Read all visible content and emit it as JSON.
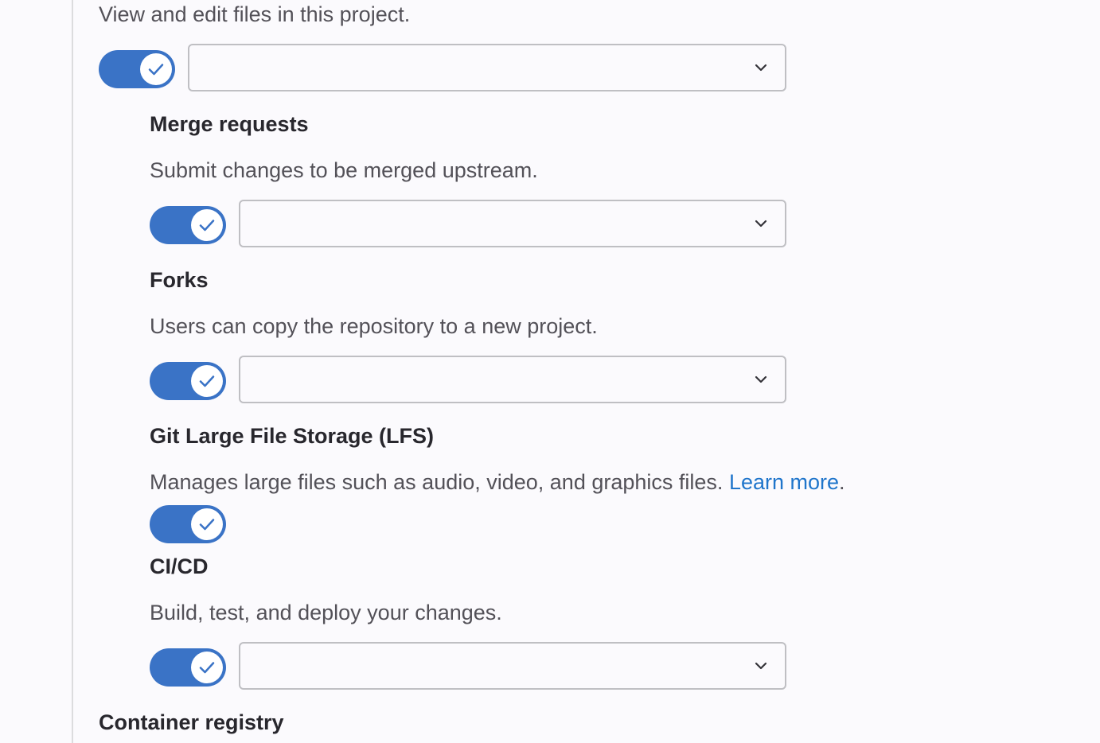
{
  "repository": {
    "description": "View and edit files in this project.",
    "toggle_enabled": true,
    "access_value": ""
  },
  "merge_requests": {
    "title": "Merge requests",
    "description": "Submit changes to be merged upstream.",
    "toggle_enabled": true,
    "access_value": ""
  },
  "forks": {
    "title": "Forks",
    "description": "Users can copy the repository to a new project.",
    "toggle_enabled": true,
    "access_value": ""
  },
  "lfs": {
    "title": "Git Large File Storage (LFS)",
    "description": "Manages large files such as audio, video, and graphics files.",
    "learn_more": "Learn more",
    "trailing_period": ".",
    "toggle_enabled": true
  },
  "cicd": {
    "title": "CI/CD",
    "description": "Build, test, and deploy your changes.",
    "toggle_enabled": true,
    "access_value": ""
  },
  "container_registry": {
    "title": "Container registry"
  },
  "icons": {
    "toggle_check": "check-icon",
    "select_chevron": "chevron-down-icon"
  },
  "colors": {
    "toggle_on": "#3a73c6",
    "link": "#1f75cb",
    "background": "#fbfafd"
  }
}
